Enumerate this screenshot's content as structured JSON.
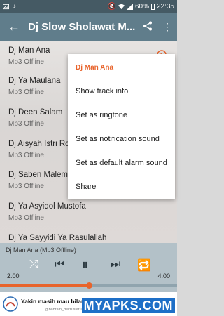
{
  "status_bar": {
    "battery": "60%",
    "time": "22:35"
  },
  "app_bar": {
    "title": "Dj Slow Sholawat M..."
  },
  "tracks": [
    {
      "title": "Dj Man Ana",
      "subtitle": "Mp3 Offline"
    },
    {
      "title": "Dj Ya Maulana",
      "subtitle": "Mp3 Offline"
    },
    {
      "title": "Dj Deen Salam",
      "subtitle": "Mp3 Offline"
    },
    {
      "title": "Dj Aisyah Istri Ro",
      "subtitle": "Mp3 Offline"
    },
    {
      "title": "Dj Saben Malem A",
      "subtitle": "Mp3 Offline"
    },
    {
      "title": "Dj Ya Asyiqol Mustofa",
      "subtitle": "Mp3 Offline"
    },
    {
      "title": "Dj Ya Sayyidi Ya Rasulallah",
      "subtitle": ""
    }
  ],
  "menu": {
    "header": "Dj Man Ana",
    "items": [
      "Show track info",
      "Set as ringtone",
      "Set as notification sound",
      "Set as default alarm sound",
      "Share"
    ]
  },
  "player": {
    "now_playing": "Dj Man Ana (Mp3 Offline)",
    "elapsed": "2:00",
    "duration": "4:00",
    "progress": 0.5
  },
  "ad": {
    "text": "Yakin masih mau bilang",
    "handle": "@bahrain_dekrusiaru"
  },
  "watermark": "MYAPKS.COM",
  "colors": {
    "accent": "#e8642c",
    "app_bar": "#607d8b"
  }
}
